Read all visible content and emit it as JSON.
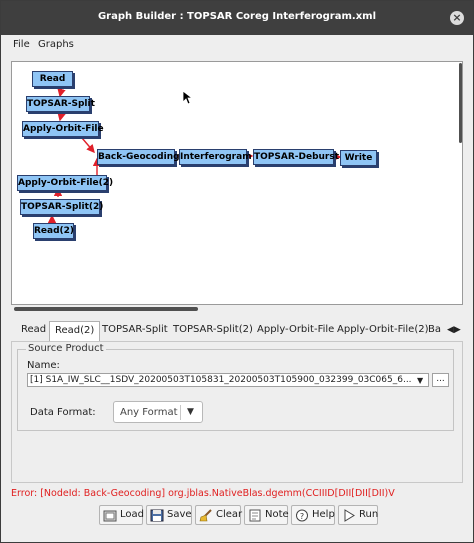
{
  "window": {
    "title": "Graph Builder : TOPSAR Coreg Interferogram.xml",
    "close_glyph": "×"
  },
  "menu": {
    "items": [
      "File",
      "Graphs"
    ]
  },
  "graph": {
    "nodes": [
      "Read",
      "TOPSAR-Split",
      "Apply-Orbit-File",
      "Back-Geocoding",
      "Interferogram",
      "TOPSAR-Deburst",
      "Write",
      "Apply-Orbit-File(2)",
      "TOPSAR-Split(2)",
      "Read(2)"
    ],
    "edge_color": "#e0202a",
    "node_color": "#8fc5f5"
  },
  "tabs": [
    "Read",
    "Read(2)",
    "TOPSAR-Split",
    "TOPSAR-Split(2)",
    "Apply-Orbit-File",
    "Apply-Orbit-File(2)",
    "Ba"
  ],
  "active_tab": "Read(2)",
  "source_product": {
    "legend": "Source Product",
    "name_label": "Name:",
    "name_value": "[1] S1A_IW_SLC__1SDV_20200503T105831_20200503T105900_032399_03C065_6...",
    "browse_label": "..."
  },
  "data_format": {
    "label": "Data Format:",
    "value": "Any Format"
  },
  "error_text": "Error: [NodeId: Back-Geocoding] org.jblas.NativeBlas.dgemm(CCIIID[DII[DII[DII)V",
  "buttons": {
    "load": "Load",
    "save": "Save",
    "clear": "Clear",
    "note": "Note",
    "help": "Help",
    "run": "Run"
  }
}
